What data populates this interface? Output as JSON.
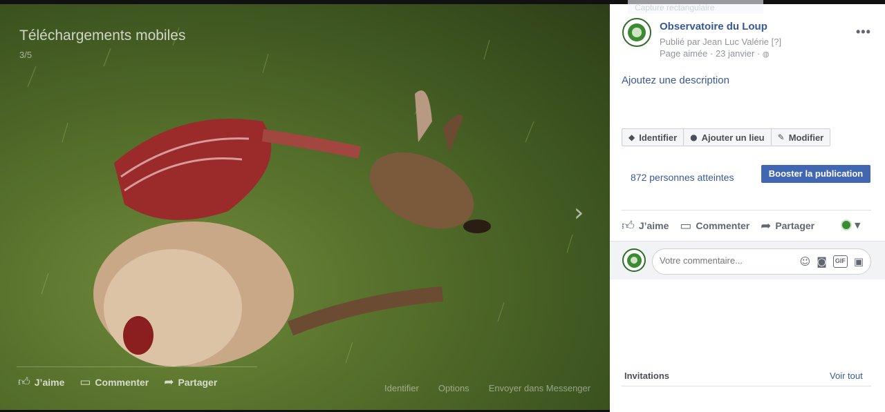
{
  "photo": {
    "album_title": "Téléchargements mobiles",
    "counter": "3/5",
    "actions": [
      {
        "label": "J’aime",
        "icon": "like-icon"
      },
      {
        "label": "Commenter",
        "icon": "comment-icon"
      },
      {
        "label": "Partager",
        "icon": "share-icon"
      }
    ],
    "links": [
      "Identifier",
      "Options",
      "Envoyer dans Messenger"
    ],
    "next_icon": "chevron-right-icon"
  },
  "capture_overlay": "Capture rectangulaire",
  "post": {
    "page_name": "Observatoire du Loup",
    "published_by": "Publié par Jean Luc Valérie",
    "help_marker": "[?]",
    "page_liked": "Page aimée",
    "date": "23 janvier",
    "privacy_icon": "globe-icon",
    "more_label": "•••",
    "add_description": "Ajoutez une description",
    "buttons": [
      {
        "label": "Identifier",
        "icon": "tag-icon"
      },
      {
        "label": "Ajouter un lieu",
        "icon": "location-pin-icon"
      },
      {
        "label": "Modifier",
        "icon": "pencil-icon"
      }
    ],
    "reach": "872 personnes atteintes",
    "boost_label": "Booster la publication",
    "actions": [
      {
        "label": "J’aime",
        "icon": "like-icon"
      },
      {
        "label": "Commenter",
        "icon": "comment-icon"
      },
      {
        "label": "Partager",
        "icon": "share-icon"
      }
    ],
    "comment_placeholder": "Votre commentaire...",
    "comment_icons": [
      "emoji-icon",
      "camera-icon",
      "gif-icon",
      "sticker-icon"
    ],
    "gif_label": "GIF",
    "invitations_label": "Invitations",
    "see_all_label": "Voir tout"
  },
  "colors": {
    "link_blue": "#365899",
    "boost_blue": "#4267b2",
    "avatar_green": "#3b8b33"
  }
}
